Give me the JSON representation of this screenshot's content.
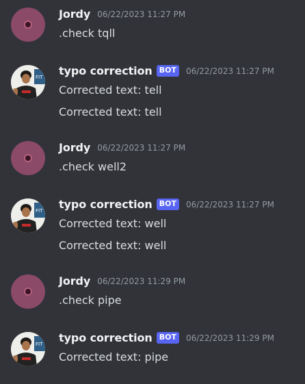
{
  "colors": {
    "background": "#313338",
    "username": "#f2f3f5",
    "message_text": "#dbdee1",
    "timestamp": "#949ba4",
    "bot_badge": "#5865f2",
    "jordy_avatar": "#8a4a68"
  },
  "messages": [
    {
      "author": "Jordy",
      "is_bot": false,
      "timestamp": "06/22/2023 11:27 PM",
      "lines": [
        ".check tqll"
      ]
    },
    {
      "author": "typo correction",
      "is_bot": true,
      "badge": "BOT",
      "timestamp": "06/22/2023 11:27 PM",
      "lines": [
        "Corrected text: tell",
        "Corrected text: tell"
      ]
    },
    {
      "author": "Jordy",
      "is_bot": false,
      "timestamp": "06/22/2023 11:27 PM",
      "lines": [
        ".check well2"
      ]
    },
    {
      "author": "typo correction",
      "is_bot": true,
      "badge": "BOT",
      "timestamp": "06/22/2023 11:27 PM",
      "lines": [
        "Corrected text: well",
        "Corrected text: well"
      ]
    },
    {
      "author": "Jordy",
      "is_bot": false,
      "timestamp": "06/22/2023 11:29 PM",
      "lines": [
        ".check pipe"
      ]
    },
    {
      "author": "typo correction",
      "is_bot": true,
      "badge": "BOT",
      "timestamp": "06/22/2023 11:29 PM",
      "lines": [
        "Corrected text: pipe"
      ]
    }
  ]
}
